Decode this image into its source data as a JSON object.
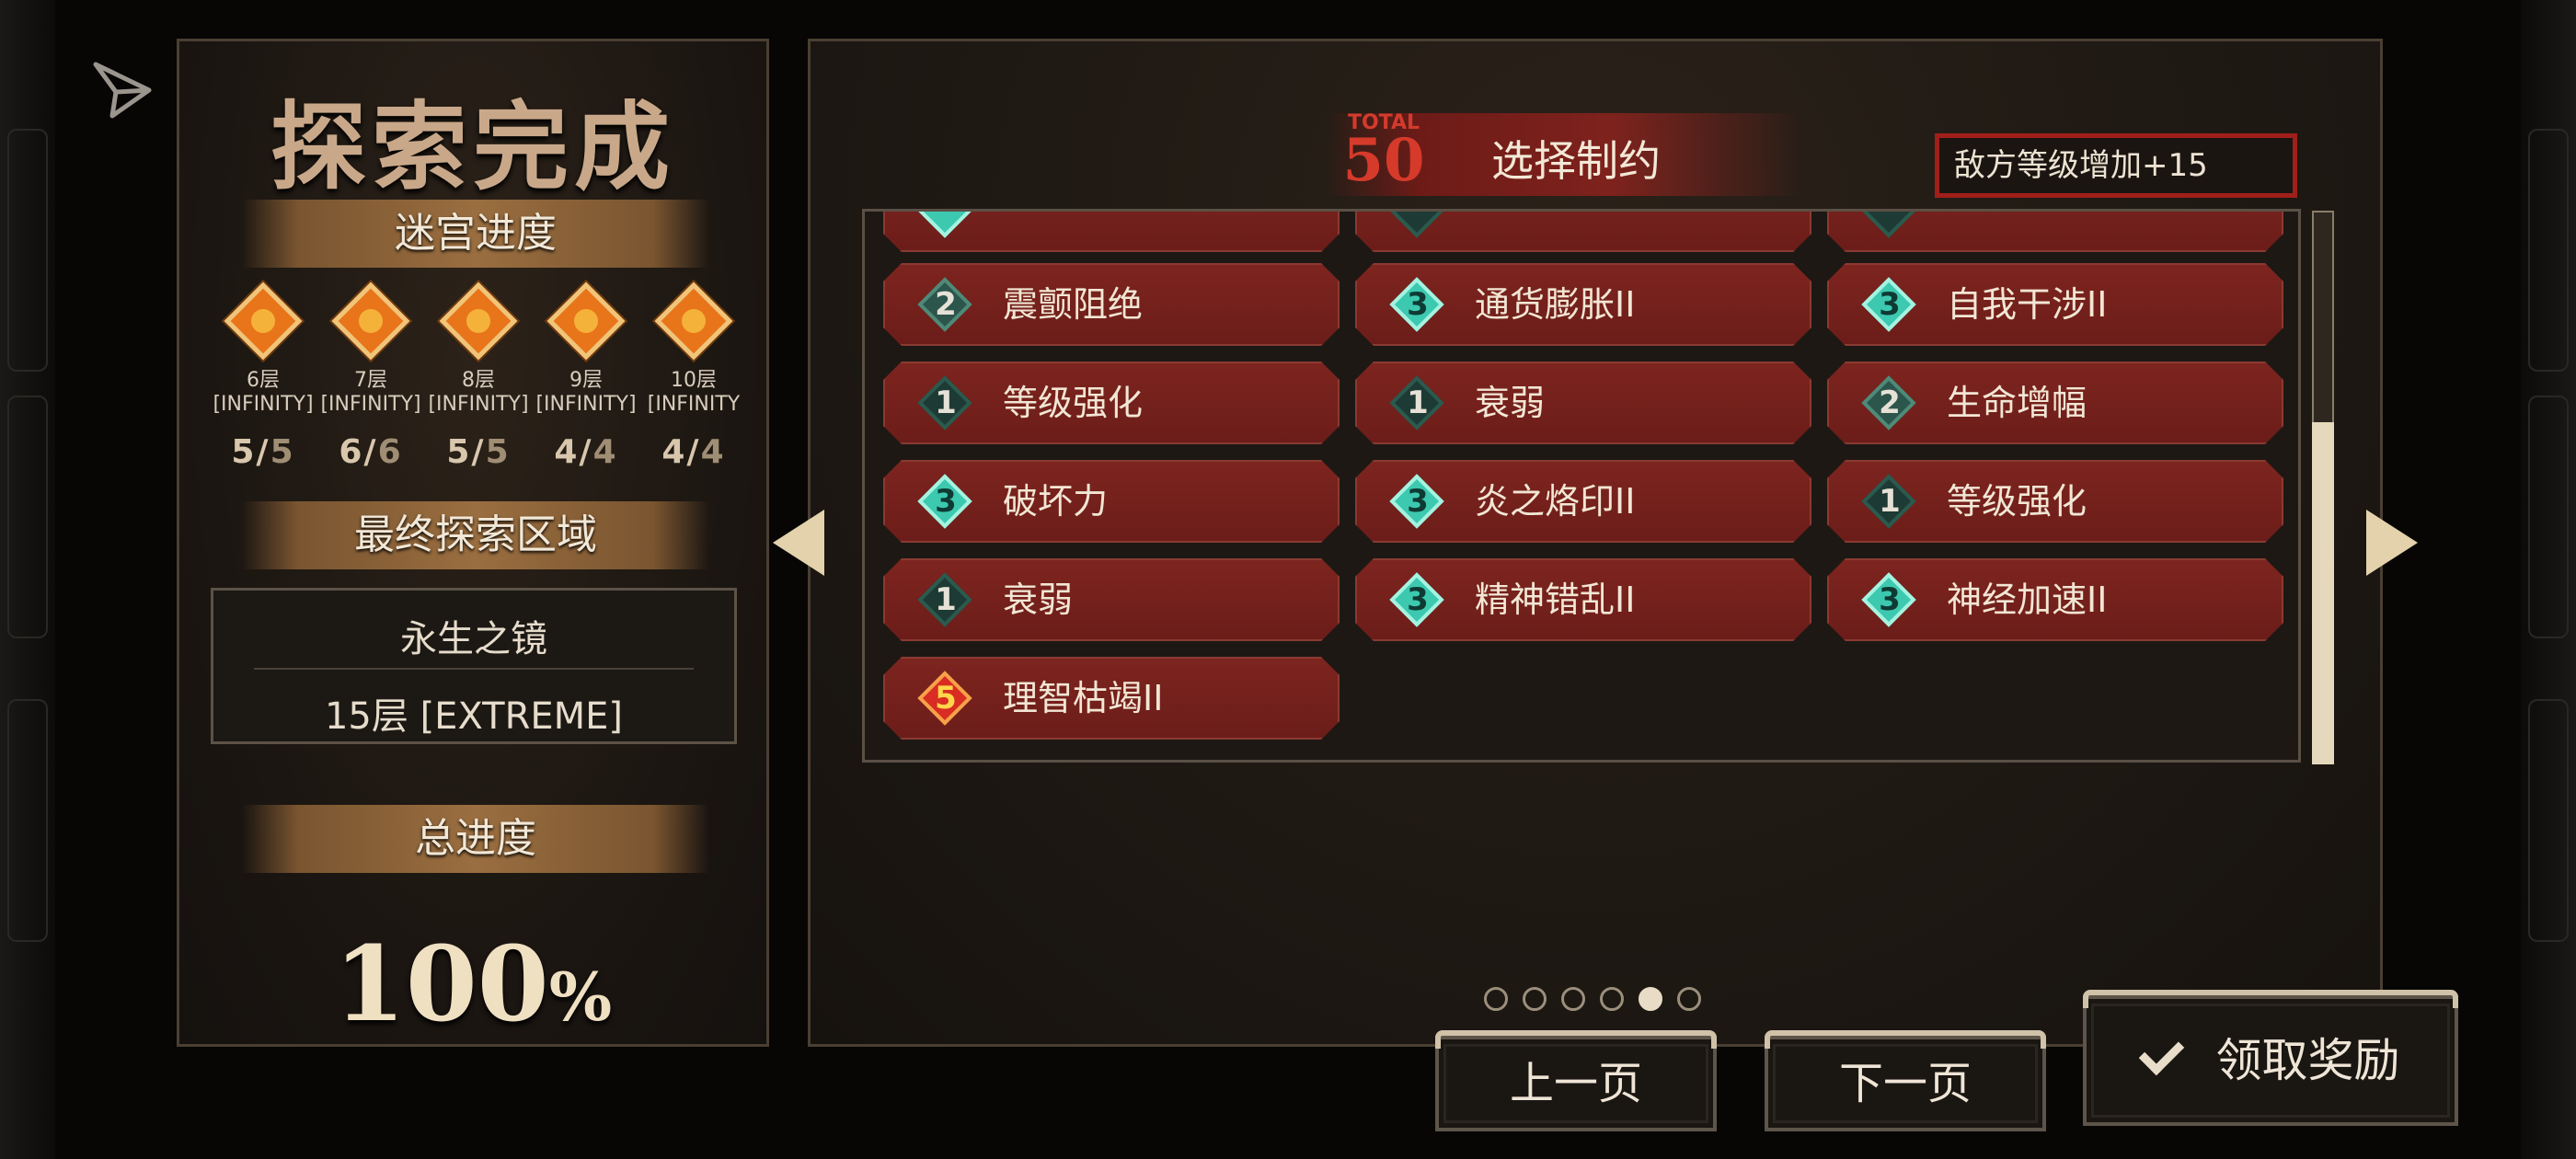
{
  "left": {
    "title": "探索完成",
    "maze_label": "迷宫进度",
    "floors": [
      {
        "name": "6层",
        "mode": "[INFINITY]",
        "done": "5",
        "total": "5"
      },
      {
        "name": "7层",
        "mode": "[INFINITY]",
        "done": "6",
        "total": "6"
      },
      {
        "name": "8层",
        "mode": "[INFINITY]",
        "done": "5",
        "total": "5"
      },
      {
        "name": "9层",
        "mode": "[INFINITY]",
        "done": "4",
        "total": "4"
      },
      {
        "name": "10层",
        "mode": "[INFINITY",
        "done": "4",
        "total": "4"
      }
    ],
    "final_area_label": "最终探索区域",
    "final_area_name": "永生之镜",
    "final_area_floor": "15层 [EXTREME]",
    "total_label": "总进度",
    "total_value": "100",
    "total_unit": "%"
  },
  "main": {
    "total_label": "TOTAL",
    "total_value": "50",
    "title": "选择制约",
    "filter_text": "敌方等级增加+15",
    "restrictions": [
      {
        "level": "2",
        "name": "震颤阻绝"
      },
      {
        "level": "3",
        "name": "通货膨胀II"
      },
      {
        "level": "3",
        "name": "自我干涉II"
      },
      {
        "level": "1",
        "name": "等级强化"
      },
      {
        "level": "1",
        "name": "衰弱"
      },
      {
        "level": "2",
        "name": "生命增幅"
      },
      {
        "level": "3",
        "name": "破坏力"
      },
      {
        "level": "3",
        "name": "炎之烙印II"
      },
      {
        "level": "1",
        "name": "等级强化"
      },
      {
        "level": "1",
        "name": "衰弱"
      },
      {
        "level": "3",
        "name": "精神错乱II"
      },
      {
        "level": "3",
        "name": "神经加速II"
      },
      {
        "level": "5",
        "name": "理智枯竭II"
      }
    ],
    "scroll_position": 0.68,
    "page_count": 6,
    "current_page": 5
  },
  "buttons": {
    "prev": "上一页",
    "next": "下一页",
    "claim": "领取奖励"
  },
  "colors": {
    "tile": "#7d241f",
    "accent_red": "#d63a2a",
    "teal": "#3cc9b0"
  },
  "icons": [
    "send-icon",
    "left-arrow-icon",
    "right-arrow-icon",
    "check-icon",
    "floor-gem-icon"
  ]
}
